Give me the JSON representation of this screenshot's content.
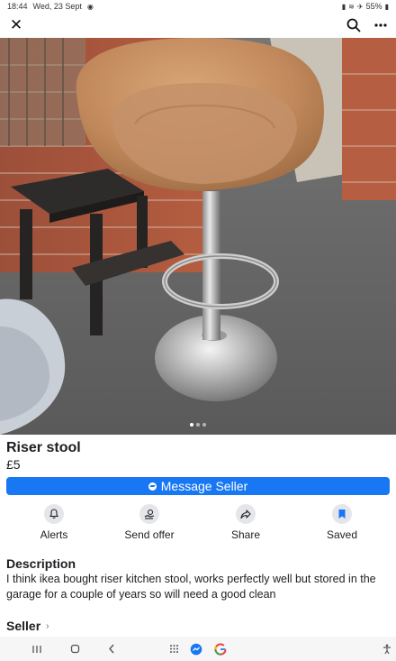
{
  "status_bar": {
    "time": "18:44",
    "date": "Wed, 23 Sept",
    "battery": "55%"
  },
  "top_bar": {
    "close_icon": "close-icon",
    "search_icon": "search-icon",
    "more_icon": "more-icon"
  },
  "photo": {
    "page_count": 3,
    "active_page": 1
  },
  "listing": {
    "title": "Riser stool",
    "price": "£5",
    "message_button_label": "Message Seller"
  },
  "actions": [
    {
      "label": "Alerts",
      "icon": "bell-icon"
    },
    {
      "label": "Send offer",
      "icon": "offer-icon"
    },
    {
      "label": "Share",
      "icon": "share-icon"
    },
    {
      "label": "Saved",
      "icon": "bookmark-icon"
    }
  ],
  "description": {
    "heading": "Description",
    "text": "I think ikea bought riser kitchen stool, works perfectly well but stored in the garage for a couple of years so will need a good clean"
  },
  "seller": {
    "heading": "Seller",
    "chevron": "›"
  },
  "colors": {
    "accent": "#1877f2",
    "text": "#1c1e21",
    "secondary_text": "#65676b",
    "icon_bg": "#e4e6eb"
  }
}
